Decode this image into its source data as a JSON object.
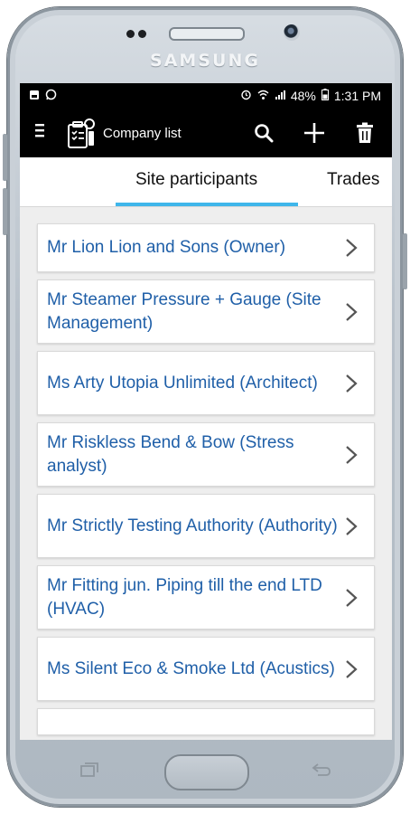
{
  "device": {
    "brand": "SAMSUNG"
  },
  "statusbar": {
    "left_icons": [
      "gallery-icon",
      "whatsapp-icon"
    ],
    "right_icons": [
      "alarm-icon",
      "wifi-icon",
      "signal-icon"
    ],
    "battery": "48%",
    "time": "1:31 PM"
  },
  "appbar": {
    "title": "Company list",
    "actions": [
      "search-icon",
      "add-icon",
      "trash-icon"
    ]
  },
  "tabs": [
    {
      "label": "Site participants",
      "active": true
    },
    {
      "label": "Trades",
      "active": false
    }
  ],
  "participants": [
    "Mr Lion Lion and Sons (Owner)",
    "Mr Steamer Pressure + Gauge (Site Management)",
    "Ms Arty Utopia Unlimited (Architect)",
    "Mr Riskless Bend & Bow (Stress analyst)",
    "Mr Strictly Testing Authority (Authority)",
    "Mr Fitting jun. Piping till the end LTD (HVAC)",
    "Ms Silent Eco & Smoke Ltd (Acustics)"
  ],
  "colors": {
    "accent": "#3fb6ea",
    "link_text": "#1f5fa8",
    "appbar_bg": "#000000"
  }
}
